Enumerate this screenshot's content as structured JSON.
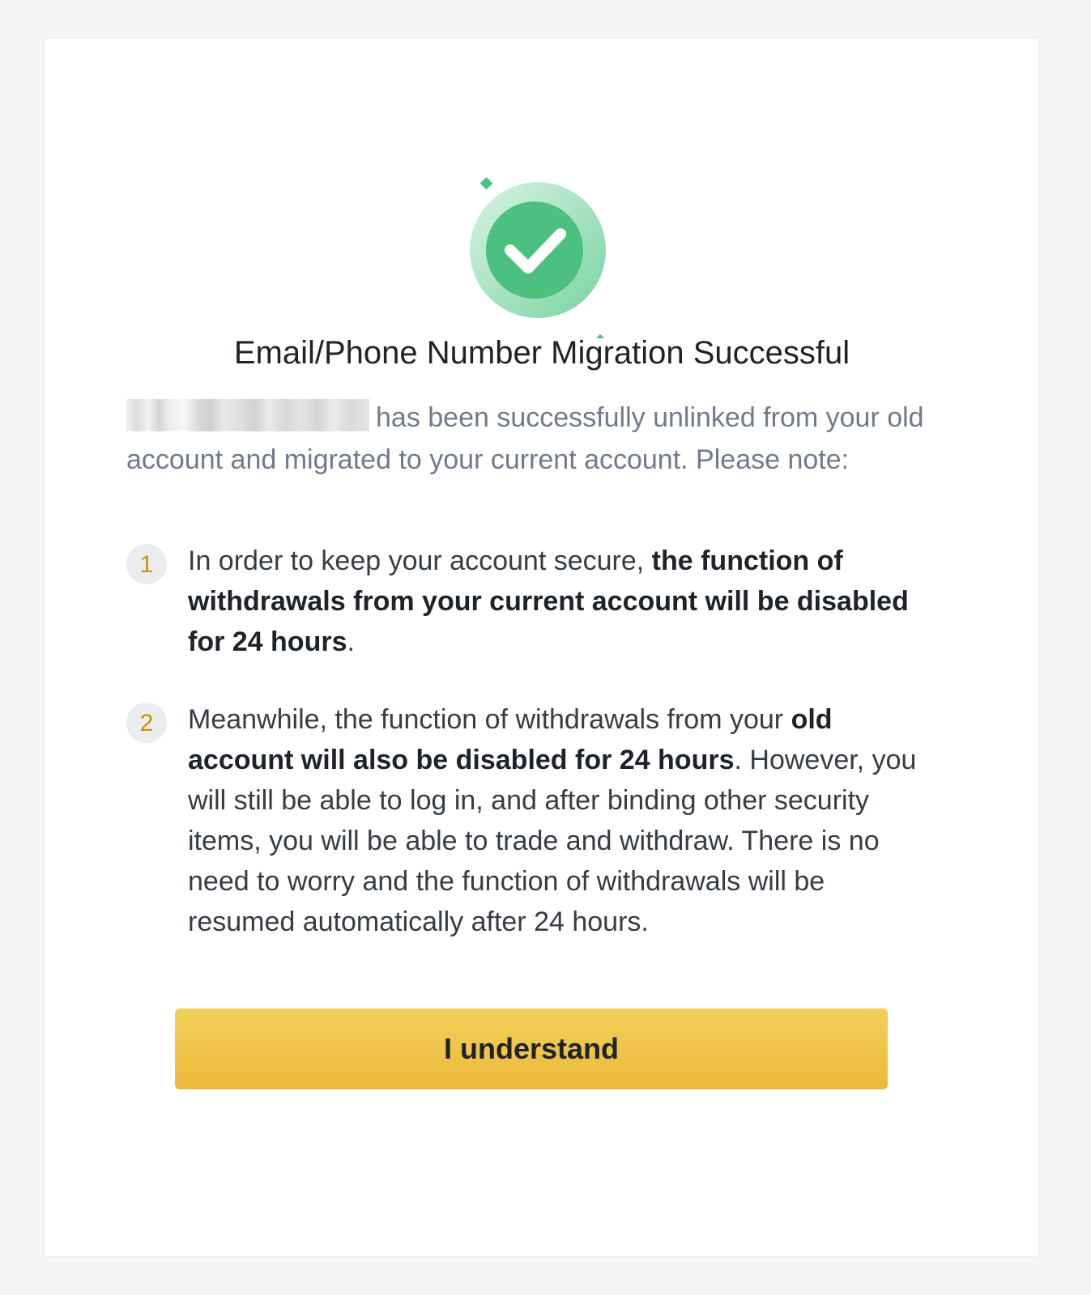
{
  "dialog": {
    "title": "Email/Phone Number Migration Successful",
    "subtitle": "has been successfully unlinked from your old account and migrated to your current account. Please note:",
    "notes": [
      {
        "number": "1",
        "text_before": "In order to keep your account secure, ",
        "text_bold": "the function of withdrawals from your current account will be disabled for 24 hours",
        "text_after": "."
      },
      {
        "number": "2",
        "text_before": "Meanwhile, the function of withdrawals from your ",
        "text_bold": "old account will also be disabled for 24 hours",
        "text_after": ". However, you will still be able to log in, and after binding other security items, you will be able to trade and withdraw. There is no need to worry and the function of withdrawals will be resumed automatically after 24 hours."
      }
    ],
    "button_label": "I understand"
  },
  "icons": {
    "success": "checkmark-circle-icon"
  },
  "colors": {
    "success_green": "#4cc07f",
    "accent_yellow": "#f0c33c",
    "number_color": "#c99400"
  }
}
